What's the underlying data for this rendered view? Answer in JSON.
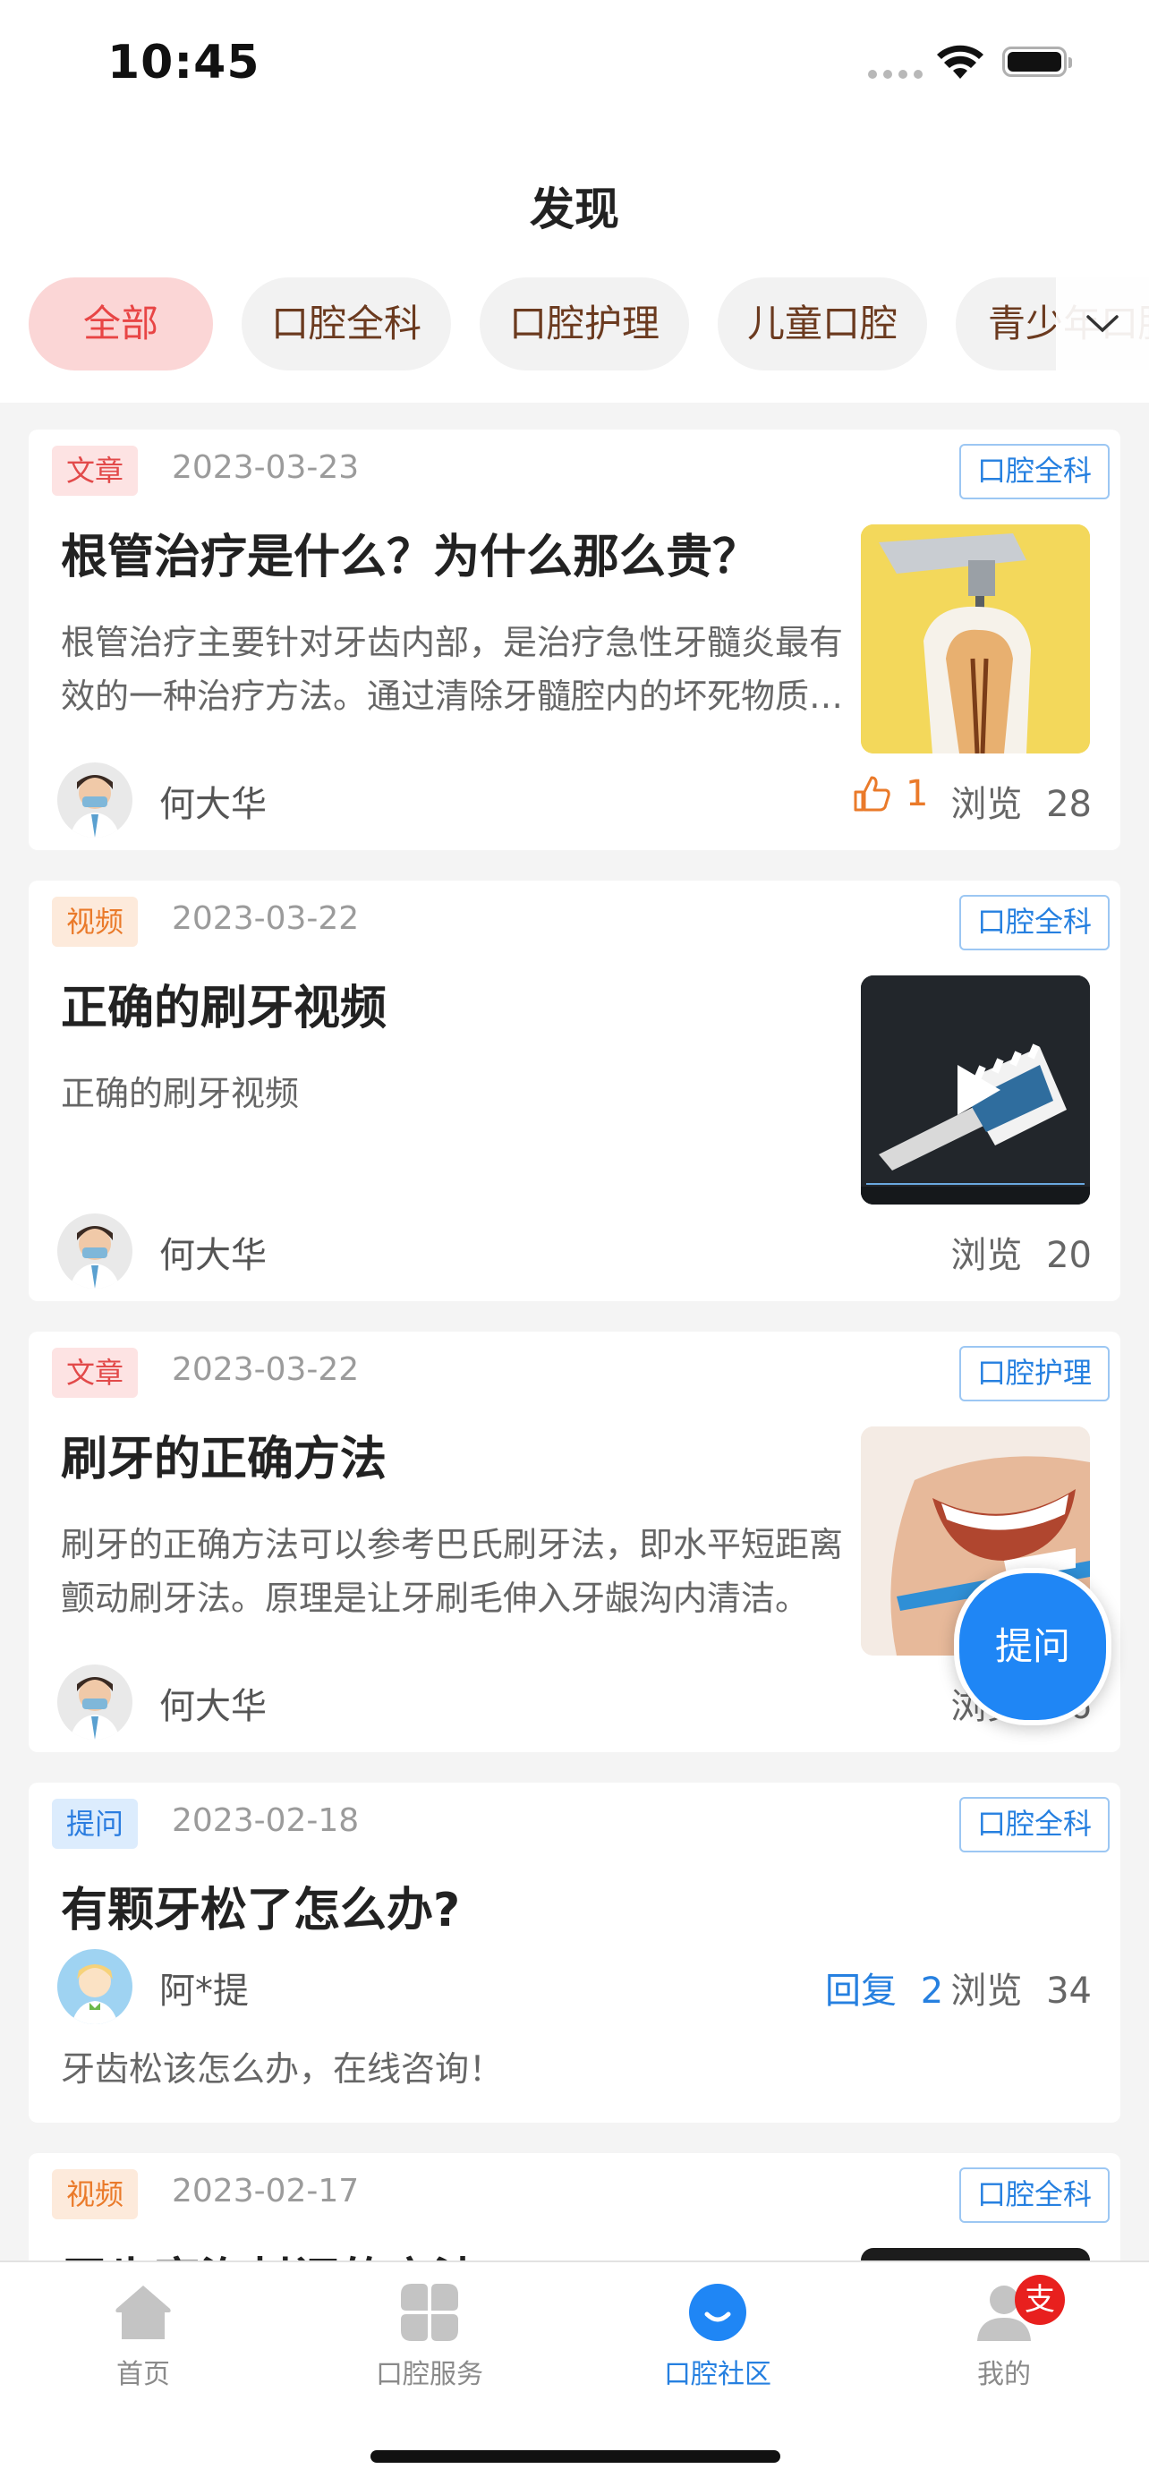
{
  "status_bar": {
    "time": "10:45"
  },
  "header": {
    "title": "发现"
  },
  "tabs": [
    {
      "label": "全部",
      "active": true
    },
    {
      "label": "口腔全科",
      "active": false
    },
    {
      "label": "口腔护理",
      "active": false
    },
    {
      "label": "儿童口腔",
      "active": false
    },
    {
      "label": "青少年口腔",
      "active": false
    }
  ],
  "feed": [
    {
      "type": "文章",
      "date": "2023-03-23",
      "category": "口腔全科",
      "title": "根管治疗是什么？为什么那么贵？",
      "summary": "根管治疗主要针对牙齿内部，是治疗急性牙髓炎最有效的一种治疗方法。通过清除牙髓腔内的坏死物质，进行消毒和充填。",
      "author": "何大华",
      "likes": "1",
      "views_label": "浏览",
      "views": "28"
    },
    {
      "type": "视频",
      "date": "2023-03-22",
      "category": "口腔全科",
      "title": "正确的刷牙视频",
      "summary": "正确的刷牙视频",
      "author": "何大华",
      "views_label": "浏览",
      "views": "20"
    },
    {
      "type": "文章",
      "date": "2023-03-22",
      "category": "口腔护理",
      "title": "刷牙的正确方法",
      "summary": "刷牙的正确方法可以参考巴氏刷牙法，即水平短距离颤动刷牙法。原理是让牙刷毛伸入牙龈沟内清洁。",
      "author": "何大华",
      "views_label": "浏览",
      "views": "16"
    },
    {
      "type": "提问",
      "date": "2023-02-18",
      "category": "口腔全科",
      "title": "有颗牙松了怎么办?",
      "author": "阿*提",
      "replies_label": "回复",
      "replies": "2",
      "views_label": "浏览",
      "views": "34",
      "summary": "牙齿松该怎么办，在线咨询！"
    },
    {
      "type": "视频",
      "date": "2023-02-17",
      "category": "口腔全科",
      "title": "牙齿窝沟封闭的方法"
    }
  ],
  "ask_button": {
    "label": "提问"
  },
  "bottom_nav": [
    {
      "label": "首页",
      "icon": "home-icon"
    },
    {
      "label": "口腔服务",
      "icon": "services-icon"
    },
    {
      "label": "口腔社区",
      "icon": "community-icon",
      "active": true
    },
    {
      "label": "我的",
      "icon": "profile-icon",
      "badge": "支"
    }
  ],
  "colors": {
    "accent_blue": "#1f86f5",
    "tab_active_bg": "#fbd6d6",
    "tab_active_text": "#e84545",
    "like_orange": "#ea7a2a"
  }
}
